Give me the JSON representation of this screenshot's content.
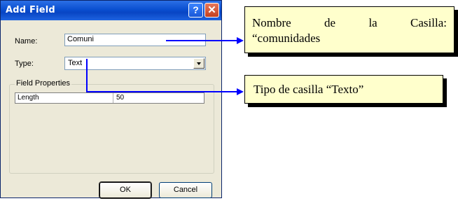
{
  "dialog": {
    "title": "Add Field",
    "help_glyph": "?",
    "close_glyph": "✕",
    "name_label": "Name:",
    "name_value": "Comuni",
    "type_label": "Type:",
    "type_value": "Text",
    "group_label": "Field Properties",
    "properties": [
      {
        "name": "Length",
        "value": "50"
      }
    ],
    "ok_label": "OK",
    "cancel_label": "Cancel"
  },
  "annotations": {
    "name_note_line1": "Nombre de la Casilla:",
    "name_note_line2": "“comunidades",
    "type_note": "Tipo de casilla “Texto”"
  },
  "colors": {
    "title_bar": "#0a4fd0",
    "dialog_bg": "#ece9d8",
    "note_bg": "#ffffcc",
    "arrow": "#0000ff"
  }
}
